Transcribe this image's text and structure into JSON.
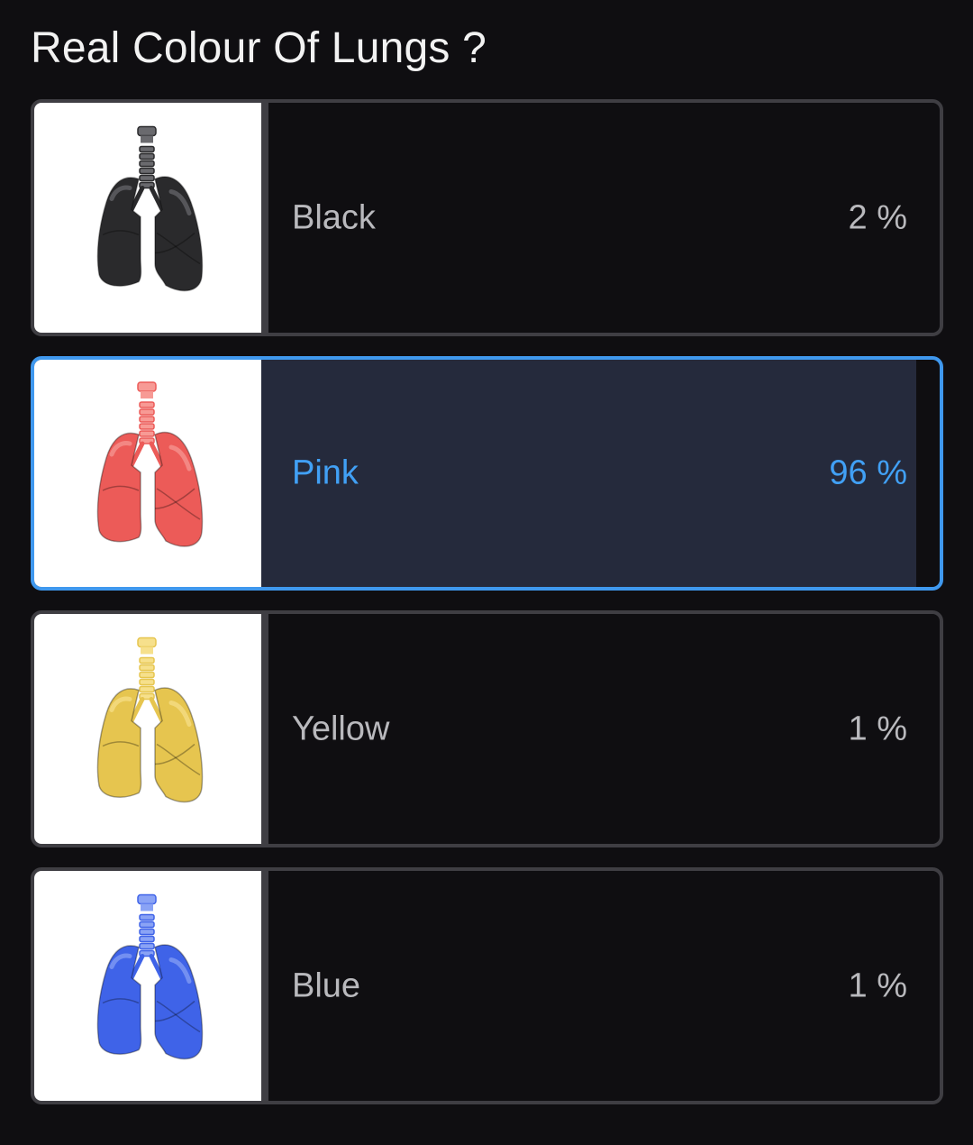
{
  "poll": {
    "question": "Real Colour Of Lungs ?",
    "options": [
      {
        "label": "Black",
        "percent_text": "2 %",
        "percent": 2,
        "selected": false,
        "image": "lungs-black-icon",
        "color": "#2a2a2c",
        "highlight": "#6a6a6e"
      },
      {
        "label": "Pink",
        "percent_text": "96 %",
        "percent": 96,
        "selected": true,
        "image": "lungs-pink-icon",
        "color": "#ec5b58",
        "highlight": "#f79a95"
      },
      {
        "label": "Yellow",
        "percent_text": "1 %",
        "percent": 1,
        "selected": false,
        "image": "lungs-yellow-icon",
        "color": "#e6c54f",
        "highlight": "#f6e08c"
      },
      {
        "label": "Blue",
        "percent_text": "1 %",
        "percent": 1,
        "selected": false,
        "image": "lungs-blue-icon",
        "color": "#3f63e8",
        "highlight": "#8aa3f5"
      }
    ]
  },
  "colors": {
    "background": "#0f0e11",
    "border": "#3f3e43",
    "selected_border": "#3f98ee",
    "selected_fill": "#252a3c",
    "selected_text": "#41a0f5",
    "text": "#b9b9bd"
  }
}
